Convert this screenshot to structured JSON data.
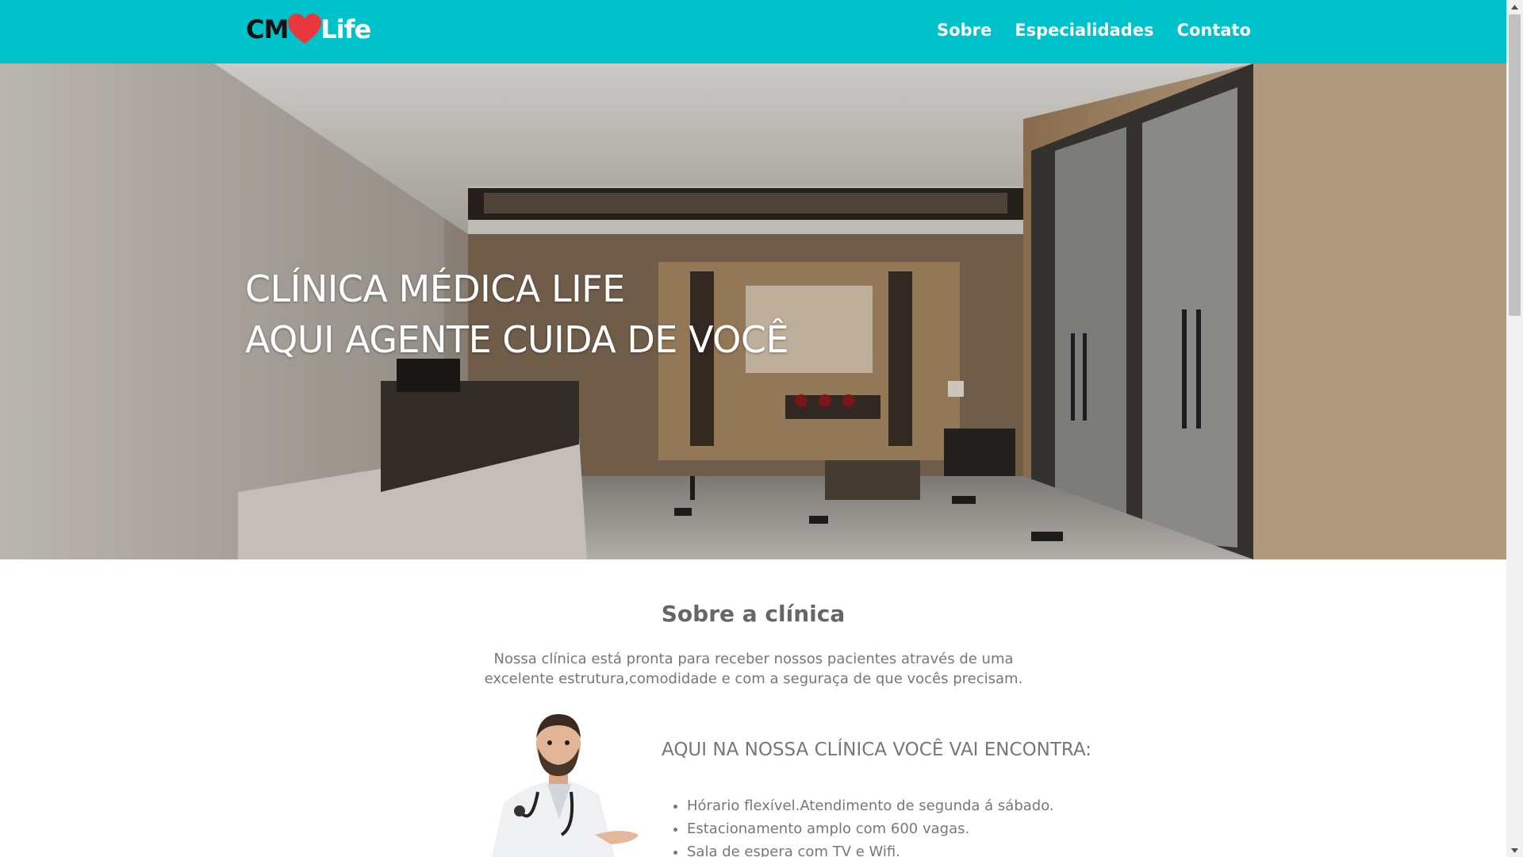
{
  "header": {
    "logo": {
      "left_text": "CM",
      "right_text": "Life",
      "heart_color": "#e8383d"
    },
    "nav": [
      {
        "label": "Sobre"
      },
      {
        "label": "Especialidades"
      },
      {
        "label": "Contato"
      }
    ],
    "background_color": "#00c2cb"
  },
  "hero": {
    "title_line1": "CLÍNICA MÉDICA LIFE",
    "title_line2": "AQUI AGENTE CUIDA DE VOCÊ"
  },
  "about": {
    "title": "Sobre a clínica",
    "description": "Nossa clínica está pronta para receber nossos pacientes através de uma excelente estrutura,comodidade e com a seguraça de que vocês precisam.",
    "features_title": "AQUI NA NOSSA CLÍNICA VOCÊ VAI ENCONTRA:",
    "features": [
      "Hórario flexível.Atendimento de segunda á sábado.",
      "Estacionamento amplo com 600 vagas.",
      "Sala de espera com TV e Wifi."
    ]
  }
}
